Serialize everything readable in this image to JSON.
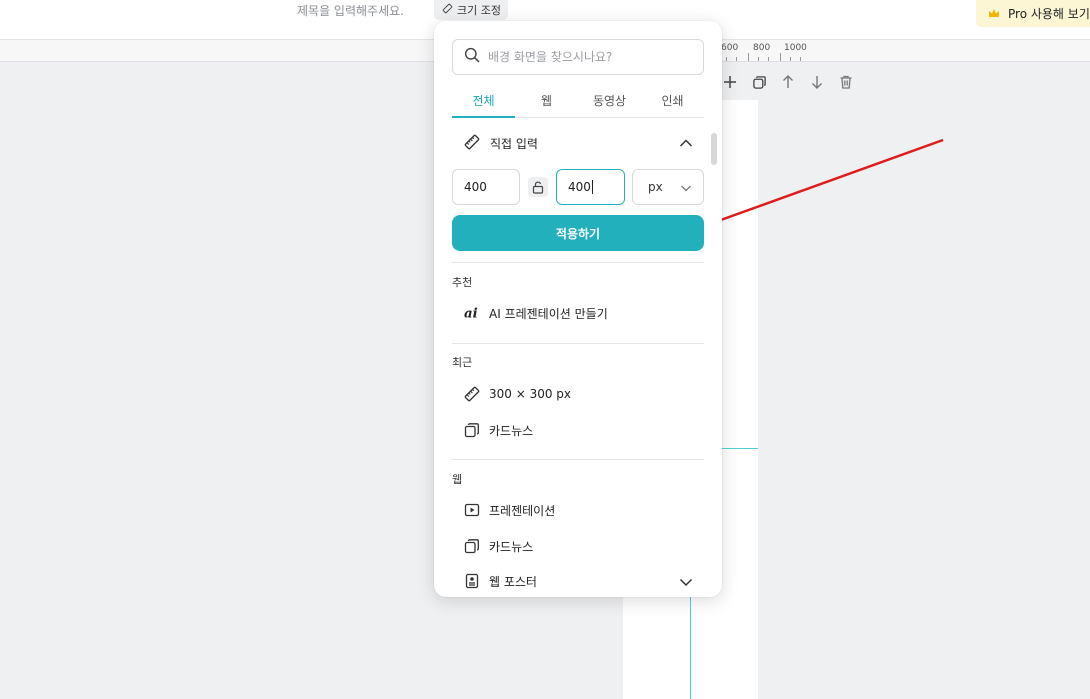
{
  "header": {
    "title_placeholder": "제목을 입력해주세요.",
    "resize_label": "크기 조정",
    "pro_label": "Pro 사용해 보기"
  },
  "ruler": {
    "labels": [
      "600",
      "800",
      "1000"
    ]
  },
  "panel": {
    "search_placeholder": "배경 화면을 찾으시나요?",
    "tabs": [
      {
        "label": "전체"
      },
      {
        "label": "웹"
      },
      {
        "label": "동영상"
      },
      {
        "label": "인쇄"
      }
    ],
    "custom": {
      "title": "직접 입력",
      "width": "400",
      "height": "400",
      "unit": "px",
      "apply_label": "적용하기"
    },
    "recommended": {
      "label": "추천",
      "items": [
        {
          "label": "AI 프레젠테이션 만들기"
        }
      ]
    },
    "recent": {
      "label": "최근",
      "items": [
        {
          "label": "300 × 300 px"
        },
        {
          "label": "카드뉴스"
        }
      ]
    },
    "web": {
      "label": "웹",
      "items": [
        {
          "label": "프레젠테이션"
        },
        {
          "label": "카드뉴스"
        },
        {
          "label": "웹 포스터"
        }
      ]
    }
  },
  "colors": {
    "accent": "#22b0bd",
    "arrow": "#e01b1b",
    "pro_bg": "#fdf6d5",
    "crown": "#f2b705"
  }
}
